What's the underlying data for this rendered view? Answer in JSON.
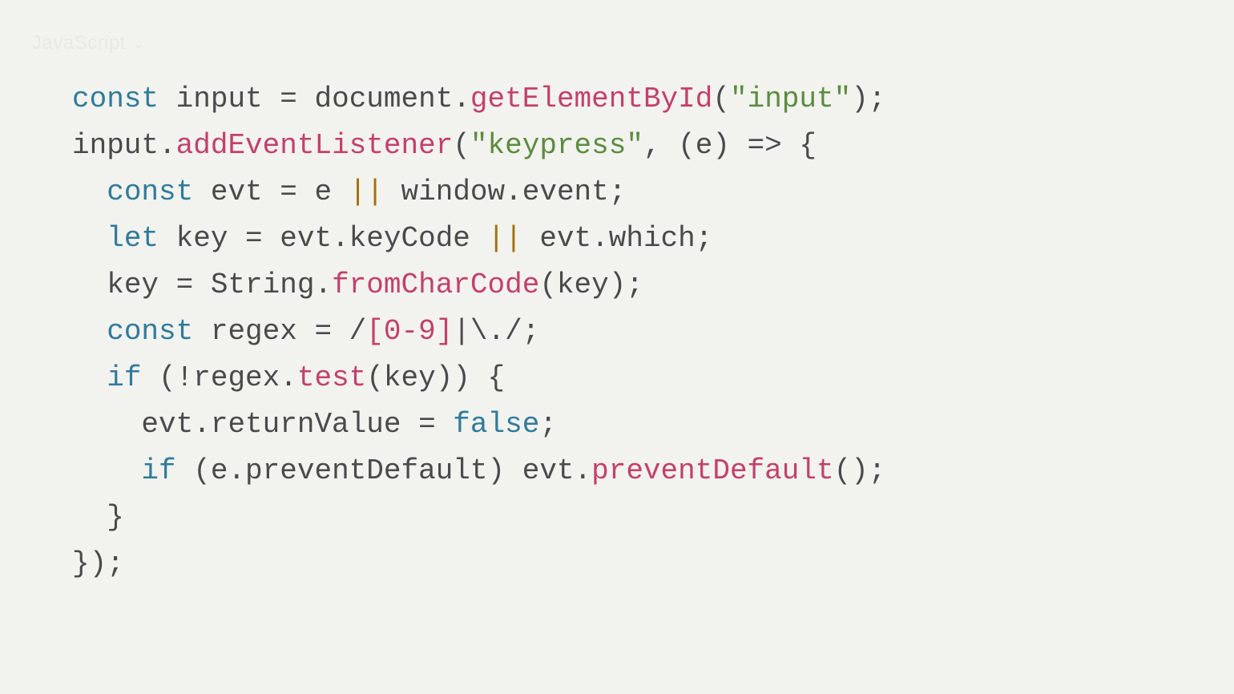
{
  "language_label": "JavaScript",
  "code": {
    "line1": {
      "kw_const": "const",
      "var_input": " input ",
      "eq": "= ",
      "doc": "document",
      "dot1": ".",
      "getEl": "getElementById",
      "open": "(",
      "str_input": "\"input\"",
      "close": ");"
    },
    "line2": {
      "input": "input",
      "dot": ".",
      "addEvt": "addEventListener",
      "open": "(",
      "str_keypress": "\"keypress\"",
      "comma_arrow": ", (e) => {"
    },
    "line3": {
      "indent": "  ",
      "kw_const": "const",
      "rest_a": " evt = e ",
      "or": "||",
      "rest_b": " window.event;"
    },
    "line4": {
      "indent": "  ",
      "kw_let": "let",
      "rest_a": " key = evt.keyCode ",
      "or": "||",
      "rest_b": " evt.which;"
    },
    "line5": {
      "indent": "  ",
      "pre": "key = String.",
      "from": "fromCharCode",
      "post": "(key);"
    },
    "line6": {
      "indent": "  ",
      "kw_const": "const",
      "pre": " regex = /",
      "body": "[0-9]",
      "post": "|\\./;"
    },
    "line7": {
      "indent": "  ",
      "kw_if": "if",
      "pre": " (!regex.",
      "test": "test",
      "post": "(key)) {"
    },
    "line8": {
      "indent": "    ",
      "pre": "evt.returnValue = ",
      "false": "false",
      "post": ";"
    },
    "line9": {
      "indent": "    ",
      "kw_if": "if",
      "pre": " (e.preventDefault) evt.",
      "prevent": "preventDefault",
      "post": "();"
    },
    "line10": "  }",
    "line11": "});"
  }
}
